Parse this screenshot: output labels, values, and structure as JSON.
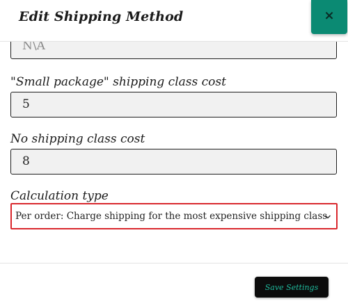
{
  "header": {
    "title": "Edit Shipping Method",
    "close_label": "×"
  },
  "form": {
    "partial_field_value": "N\\A",
    "small_package_label": "\"Small package\" shipping class cost",
    "small_package_value": "5",
    "no_class_label": "No shipping class cost",
    "no_class_value": "8",
    "calc_type_label": "Calculation type",
    "calc_type_value": "Per order: Charge shipping for the most expensive shipping class"
  },
  "footer": {
    "save_label": "Save Settings"
  },
  "colors": {
    "accent": "#0b8a73",
    "focus_border": "#d9262c",
    "save_text": "#1fb99c"
  },
  "icons": {
    "close": "close-icon",
    "select": "chevron-down-icon"
  }
}
